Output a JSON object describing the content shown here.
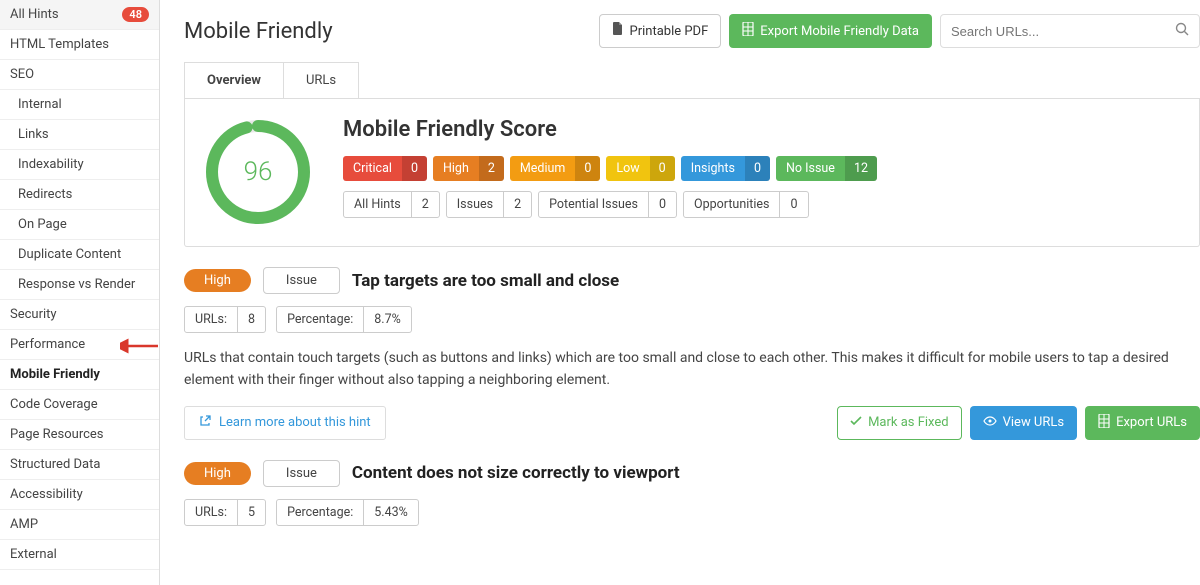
{
  "sidebar": {
    "items": [
      {
        "label": "All Hints",
        "badge": "48",
        "indent": false,
        "active": false
      },
      {
        "label": "HTML Templates",
        "indent": false,
        "active": false
      },
      {
        "label": "SEO",
        "indent": false,
        "active": false
      },
      {
        "label": "Internal",
        "indent": true,
        "active": false
      },
      {
        "label": "Links",
        "indent": true,
        "active": false
      },
      {
        "label": "Indexability",
        "indent": true,
        "active": false
      },
      {
        "label": "Redirects",
        "indent": true,
        "active": false
      },
      {
        "label": "On Page",
        "indent": true,
        "active": false
      },
      {
        "label": "Duplicate Content",
        "indent": true,
        "active": false
      },
      {
        "label": "Response vs Render",
        "indent": true,
        "active": false
      },
      {
        "label": "Security",
        "indent": false,
        "active": false
      },
      {
        "label": "Performance",
        "indent": false,
        "active": false
      },
      {
        "label": "Mobile Friendly",
        "indent": false,
        "active": true
      },
      {
        "label": "Code Coverage",
        "indent": false,
        "active": false
      },
      {
        "label": "Page Resources",
        "indent": false,
        "active": false
      },
      {
        "label": "Structured Data",
        "indent": false,
        "active": false
      },
      {
        "label": "Accessibility",
        "indent": false,
        "active": false
      },
      {
        "label": "AMP",
        "indent": false,
        "active": false
      },
      {
        "label": "External",
        "indent": false,
        "active": false
      }
    ]
  },
  "header": {
    "title": "Mobile Friendly",
    "printable": "Printable PDF",
    "export": "Export Mobile Friendly Data",
    "search_placeholder": "Search URLs..."
  },
  "tabs": [
    {
      "label": "Overview",
      "active": true
    },
    {
      "label": "URLs",
      "active": false
    }
  ],
  "score_panel": {
    "title": "Mobile Friendly Score",
    "score": "96",
    "severities": [
      {
        "label": "Critical",
        "count": "0",
        "cls": "sev-critical"
      },
      {
        "label": "High",
        "count": "2",
        "cls": "sev-high"
      },
      {
        "label": "Medium",
        "count": "0",
        "cls": "sev-medium"
      },
      {
        "label": "Low",
        "count": "0",
        "cls": "sev-low"
      },
      {
        "label": "Insights",
        "count": "0",
        "cls": "sev-insights"
      },
      {
        "label": "No Issue",
        "count": "12",
        "cls": "sev-noissue"
      }
    ],
    "filters": [
      {
        "label": "All Hints",
        "count": "2"
      },
      {
        "label": "Issues",
        "count": "2"
      },
      {
        "label": "Potential Issues",
        "count": "0"
      },
      {
        "label": "Opportunities",
        "count": "0"
      }
    ]
  },
  "hints": [
    {
      "severity": "High",
      "type": "Issue",
      "title": "Tap targets are too small and close",
      "urls_label": "URLs:",
      "urls_count": "8",
      "pct_label": "Percentage:",
      "pct_value": "8.7%",
      "desc": "URLs that contain touch targets (such as buttons and links) which are too small and close to each other. This makes it difficult for mobile users to tap a desired element with their finger without also tapping a neighboring element.",
      "learn": "Learn more about this hint",
      "mark_fixed": "Mark as Fixed",
      "view_urls": "View URLs",
      "export_urls": "Export URLs"
    },
    {
      "severity": "High",
      "type": "Issue",
      "title": "Content does not size correctly to viewport",
      "urls_label": "URLs:",
      "urls_count": "5",
      "pct_label": "Percentage:",
      "pct_value": "5.43%"
    }
  ],
  "chart_data": {
    "type": "donut",
    "title": "Mobile Friendly Score",
    "value": 96,
    "max": 100,
    "color_fill": "#5cb85c",
    "color_track": "#e8e8e8"
  }
}
